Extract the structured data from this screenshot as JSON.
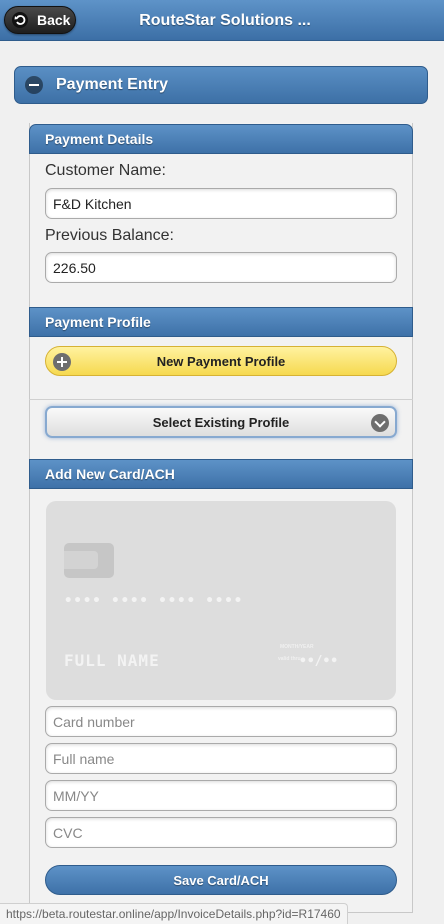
{
  "header": {
    "back_label": "Back",
    "title": "RouteStar Solutions ..."
  },
  "collapsible": {
    "title": "Payment Entry"
  },
  "payment_details": {
    "heading": "Payment Details",
    "customer_name_label": "Customer Name:",
    "customer_name_value": "F&D Kitchen",
    "previous_balance_label": "Previous Balance:",
    "previous_balance_value": "226.50"
  },
  "payment_profile": {
    "heading": "Payment Profile",
    "new_profile_label": "New Payment Profile",
    "select_existing_label": "Select Existing Profile"
  },
  "add_card": {
    "heading": "Add New Card/ACH",
    "card_preview": {
      "number": "•••• •••• •••• ••••",
      "name": "FULL NAME",
      "valid_thru_label": "month/year",
      "valid_label": "valid thru",
      "expiry": "••/••"
    },
    "card_number_placeholder": "Card number",
    "full_name_placeholder": "Full name",
    "expiry_placeholder": "MM/YY",
    "cvc_placeholder": "CVC",
    "save_label": "Save Card/ACH"
  },
  "status_bar": {
    "url": "https://beta.routestar.online/app/InvoiceDetails.php?id=R17460"
  },
  "colors": {
    "header_blue": "#4a7db5",
    "yellow_button": "#f6d94f",
    "panel_background": "#f2f2f2"
  }
}
